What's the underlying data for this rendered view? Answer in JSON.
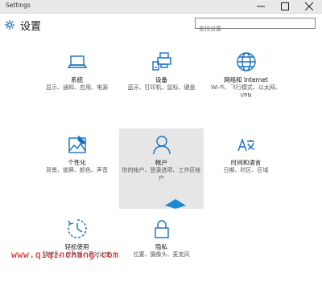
{
  "window": {
    "title": "Settings"
  },
  "header": {
    "title": "设置",
    "search_placeholder": "查找设置"
  },
  "tiles": [
    {
      "name": "系统",
      "desc": "显示、通知、应用、电源",
      "icon": "laptop-icon"
    },
    {
      "name": "设备",
      "desc": "蓝牙、打印机、鼠标、键盘",
      "icon": "devices-icon"
    },
    {
      "name": "网络和 Internet",
      "desc": "Wi-Fi、飞行模式、以太网、VPN",
      "icon": "globe-icon"
    },
    {
      "name": "个性化",
      "desc": "背景、锁屏、颜色、声音",
      "icon": "personalization-icon"
    },
    {
      "name": "帐户",
      "desc": "你的帐户、登录选项、工作区帐户",
      "icon": "person-icon"
    },
    {
      "name": "时间和语言",
      "desc": "日期、时区、区域",
      "icon": "time-language-icon"
    },
    {
      "name": "轻松使用",
      "desc": "讲述人、放大镜、高对比度",
      "icon": "ease-of-access-icon"
    },
    {
      "name": "隐私",
      "desc": "位置、摄像头、麦克风",
      "icon": "lock-icon"
    }
  ],
  "colors": {
    "accent": "#1570c4",
    "hover_tile": "#e6e6e6",
    "watermark": "#e01010"
  },
  "watermark": "www.qiqinchang.com"
}
